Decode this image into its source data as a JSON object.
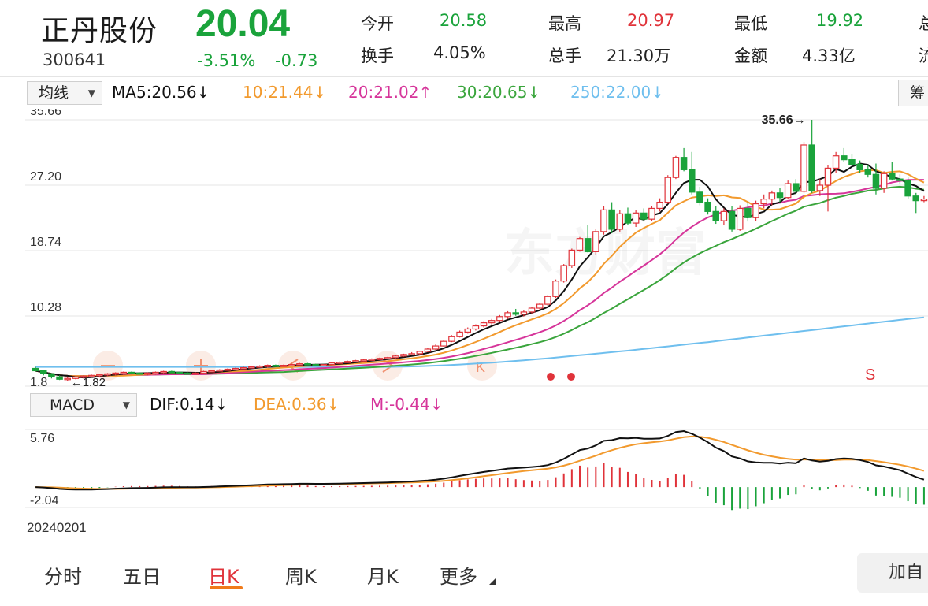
{
  "stock": {
    "name": "正丹股份",
    "code": "300641",
    "price": "20.04",
    "change_pct": "-3.51%",
    "change_amt": "-0.73"
  },
  "stats": {
    "open_label": "今开",
    "open": "20.58",
    "high_label": "最高",
    "high": "20.97",
    "low_label": "最低",
    "low": "19.92",
    "turnover_label": "换手",
    "turnover": "4.05%",
    "volume_label": "总手",
    "volume": "21.30万",
    "amount_label": "金额",
    "amount": "4.33亿",
    "cut1": "总",
    "cut2": "流"
  },
  "ma_bar": {
    "selector": "均线",
    "ma5": "MA5:20.56↓",
    "ma10": "10:21.44↓",
    "ma20": "20:21.02↑",
    "ma30": "30:20.65↓",
    "ma250": "250:22.00↓",
    "side_button": "筹"
  },
  "colors": {
    "up": "#e0333a",
    "down": "#1aa33b",
    "ma5": "#111111",
    "ma10": "#f29a2e",
    "ma20": "#d6359a",
    "ma30": "#3aa53c",
    "ma250": "#6fbfee"
  },
  "chart_data": {
    "type": "candlestick",
    "y_ticks": [
      "35.66",
      "27.20",
      "18.74",
      "10.28"
    ],
    "ylim": [
      1.82,
      35.66
    ],
    "max_annotation": "35.66",
    "min_annotation": "1.82",
    "left_edge_label": "1.8",
    "signal_label": "S",
    "candles": [
      [
        3.5,
        3.7,
        3.1,
        3.2
      ],
      [
        3.2,
        3.3,
        2.6,
        2.8
      ],
      [
        2.8,
        2.9,
        2.2,
        2.4
      ],
      [
        2.4,
        2.6,
        2.0,
        2.1
      ],
      [
        2.1,
        2.4,
        1.82,
        2.2
      ],
      [
        2.2,
        2.5,
        2.1,
        2.4
      ],
      [
        2.4,
        2.6,
        2.2,
        2.5
      ],
      [
        2.5,
        2.7,
        2.3,
        2.6
      ],
      [
        2.6,
        2.8,
        2.4,
        2.7
      ],
      [
        2.7,
        2.9,
        2.5,
        2.8
      ],
      [
        2.8,
        3.0,
        2.6,
        2.9
      ],
      [
        2.9,
        3.1,
        2.7,
        3.0
      ],
      [
        3.0,
        3.1,
        2.8,
        2.9
      ],
      [
        2.9,
        3.0,
        2.7,
        2.8
      ],
      [
        2.8,
        3.0,
        2.6,
        2.9
      ],
      [
        2.9,
        3.1,
        2.7,
        3.0
      ],
      [
        3.0,
        3.2,
        2.8,
        3.1
      ],
      [
        3.1,
        3.2,
        2.9,
        3.0
      ],
      [
        3.0,
        3.1,
        2.8,
        2.9
      ],
      [
        2.9,
        3.0,
        2.7,
        2.8
      ],
      [
        2.8,
        3.0,
        2.7,
        2.9
      ],
      [
        2.9,
        3.2,
        2.8,
        3.1
      ],
      [
        3.1,
        3.3,
        3.0,
        3.2
      ],
      [
        3.2,
        3.4,
        3.1,
        3.3
      ],
      [
        3.3,
        3.5,
        3.2,
        3.4
      ],
      [
        3.4,
        3.6,
        3.3,
        3.5
      ],
      [
        3.5,
        3.7,
        3.4,
        3.6
      ],
      [
        3.6,
        3.8,
        3.5,
        3.7
      ],
      [
        3.7,
        3.9,
        3.6,
        3.8
      ],
      [
        3.8,
        4.0,
        3.6,
        3.9
      ],
      [
        3.9,
        4.0,
        3.7,
        3.8
      ],
      [
        3.8,
        4.0,
        3.7,
        3.9
      ],
      [
        3.9,
        4.1,
        3.8,
        4.0
      ],
      [
        4.0,
        4.2,
        3.9,
        4.1
      ],
      [
        4.1,
        4.2,
        3.9,
        4.0
      ],
      [
        4.0,
        4.1,
        3.8,
        3.9
      ],
      [
        3.9,
        4.0,
        3.8,
        4.0
      ],
      [
        4.0,
        4.3,
        3.9,
        4.2
      ],
      [
        4.2,
        4.4,
        4.1,
        4.3
      ],
      [
        4.3,
        4.5,
        4.2,
        4.4
      ],
      [
        4.4,
        4.6,
        4.3,
        4.5
      ],
      [
        4.5,
        4.7,
        4.4,
        4.6
      ],
      [
        4.6,
        4.8,
        4.5,
        4.7
      ],
      [
        4.7,
        4.9,
        4.6,
        4.8
      ],
      [
        4.8,
        5.0,
        4.7,
        4.9
      ],
      [
        4.9,
        5.2,
        4.8,
        5.1
      ],
      [
        5.1,
        5.4,
        5.0,
        5.3
      ],
      [
        5.3,
        5.6,
        5.2,
        5.4
      ],
      [
        5.4,
        5.8,
        5.3,
        5.7
      ],
      [
        5.7,
        6.2,
        5.6,
        6.0
      ],
      [
        6.0,
        6.6,
        5.9,
        6.4
      ],
      [
        6.4,
        7.2,
        6.3,
        7.0
      ],
      [
        7.0,
        7.8,
        6.9,
        7.6
      ],
      [
        7.6,
        8.4,
        7.5,
        8.2
      ],
      [
        8.2,
        8.8,
        8.0,
        8.6
      ],
      [
        8.6,
        9.2,
        8.4,
        9.0
      ],
      [
        9.0,
        9.6,
        8.8,
        9.4
      ],
      [
        9.4,
        9.9,
        9.1,
        9.7
      ],
      [
        9.7,
        10.4,
        9.5,
        10.2
      ],
      [
        10.2,
        10.9,
        9.9,
        10.7
      ],
      [
        10.7,
        11.2,
        10.3,
        10.5
      ],
      [
        10.5,
        11.0,
        10.2,
        10.8
      ],
      [
        10.8,
        11.5,
        10.6,
        11.3
      ],
      [
        11.3,
        12.0,
        11.0,
        11.8
      ],
      [
        11.8,
        13.0,
        11.6,
        12.8
      ],
      [
        12.8,
        15.0,
        12.6,
        14.8
      ],
      [
        14.8,
        17.0,
        14.6,
        16.8
      ],
      [
        16.8,
        19.0,
        16.5,
        18.8
      ],
      [
        18.8,
        20.5,
        18.6,
        20.3
      ],
      [
        20.3,
        22.0,
        18.5,
        18.6
      ],
      [
        18.6,
        21.5,
        18.2,
        21.2
      ],
      [
        21.2,
        24.5,
        20.8,
        24.0
      ],
      [
        24.0,
        25.0,
        21.0,
        21.5
      ],
      [
        21.5,
        24.0,
        21.2,
        23.5
      ],
      [
        23.5,
        24.3,
        22.0,
        22.3
      ],
      [
        22.3,
        24.0,
        21.8,
        23.6
      ],
      [
        23.6,
        24.2,
        22.5,
        22.8
      ],
      [
        22.8,
        24.5,
        22.6,
        24.2
      ],
      [
        24.2,
        25.5,
        23.8,
        25.0
      ],
      [
        25.0,
        28.5,
        24.8,
        28.2
      ],
      [
        28.2,
        31.0,
        28.0,
        30.8
      ],
      [
        30.8,
        32.0,
        29.0,
        29.2
      ],
      [
        29.2,
        31.5,
        26.0,
        26.3
      ],
      [
        26.3,
        27.0,
        24.6,
        25.0
      ],
      [
        25.0,
        25.5,
        23.4,
        23.8
      ],
      [
        23.8,
        24.5,
        22.2,
        22.6
      ],
      [
        22.6,
        24.2,
        22.0,
        23.8
      ],
      [
        23.8,
        24.5,
        21.2,
        21.5
      ],
      [
        21.5,
        24.6,
        21.3,
        24.2
      ],
      [
        24.2,
        25.0,
        22.5,
        23.0
      ],
      [
        23.0,
        25.2,
        22.6,
        24.8
      ],
      [
        24.8,
        26.0,
        24.2,
        25.4
      ],
      [
        25.4,
        26.5,
        24.6,
        26.2
      ],
      [
        26.2,
        26.8,
        25.0,
        25.6
      ],
      [
        25.6,
        27.8,
        25.4,
        27.4
      ],
      [
        27.4,
        28.0,
        26.0,
        26.4
      ],
      [
        26.4,
        32.8,
        26.2,
        32.4
      ],
      [
        32.4,
        35.66,
        26.2,
        26.5
      ],
      [
        26.5,
        28.0,
        25.8,
        27.2
      ],
      [
        27.2,
        29.8,
        23.8,
        29.4
      ],
      [
        29.4,
        31.5,
        28.8,
        31.0
      ],
      [
        31.0,
        32.0,
        30.2,
        30.5
      ],
      [
        30.5,
        31.2,
        29.6,
        29.9
      ],
      [
        29.9,
        30.4,
        28.8,
        29.2
      ],
      [
        29.2,
        29.8,
        28.2,
        28.6
      ],
      [
        28.6,
        30.0,
        26.0,
        26.8
      ],
      [
        26.8,
        29.0,
        26.2,
        28.7
      ],
      [
        28.7,
        30.2,
        27.8,
        28.0
      ],
      [
        28.0,
        28.6,
        27.4,
        27.8
      ],
      [
        27.8,
        28.2,
        25.4,
        25.8
      ],
      [
        25.8,
        26.2,
        23.6,
        25.2
      ],
      [
        25.2,
        25.8,
        25.0,
        25.4
      ]
    ],
    "ma_series": [
      "MA5",
      "MA10",
      "MA20",
      "MA30",
      "MA250"
    ],
    "ma250": [
      3.7,
      3.7,
      3.7,
      3.7,
      3.7,
      3.7,
      3.7,
      3.7,
      3.7,
      3.7,
      3.7,
      3.7,
      3.7,
      3.7,
      3.7,
      3.7,
      3.7,
      3.7,
      3.7,
      3.7,
      3.7,
      3.7,
      3.7,
      3.7,
      3.7,
      3.7,
      3.7,
      3.7,
      3.7,
      3.7,
      3.7,
      3.7,
      3.7,
      3.7,
      3.7,
      3.7,
      3.7,
      3.7,
      3.7,
      3.7,
      3.7,
      3.7,
      3.7,
      3.7,
      3.7,
      3.72,
      3.74,
      3.76,
      3.79,
      3.82,
      3.86,
      3.9,
      3.95,
      4.0,
      4.06,
      4.12,
      4.18,
      4.25,
      4.32,
      4.39,
      4.47,
      4.55,
      4.63,
      4.72,
      4.81,
      4.9,
      5.0,
      5.1,
      5.2,
      5.3,
      5.4,
      5.5,
      5.6,
      5.7,
      5.8,
      5.91,
      6.02,
      6.13,
      6.24,
      6.35,
      6.46,
      6.57,
      6.68,
      6.79,
      6.9,
      7.02,
      7.14,
      7.26,
      7.38,
      7.5,
      7.62,
      7.74,
      7.86,
      7.98,
      8.1,
      8.22,
      8.34,
      8.46,
      8.58,
      8.7,
      8.82,
      8.94,
      9.06,
      9.18,
      9.3,
      9.42,
      9.54,
      9.66,
      9.78,
      9.9,
      10.0,
      10.1
    ]
  },
  "macd_bar": {
    "selector": "MACD",
    "dif": "DIF:0.14↓",
    "dea": "DEA:0.36↓",
    "m": "M:-0.44↓"
  },
  "macd_data": {
    "y_ticks": [
      "5.76",
      "-2.04"
    ],
    "ylim": [
      -2.04,
      5.76
    ]
  },
  "date_label": "20240201",
  "tabs": [
    "分时",
    "五日",
    "日K",
    "周K",
    "月K",
    "更多"
  ],
  "active_tab": "日K",
  "add_button": "加自"
}
